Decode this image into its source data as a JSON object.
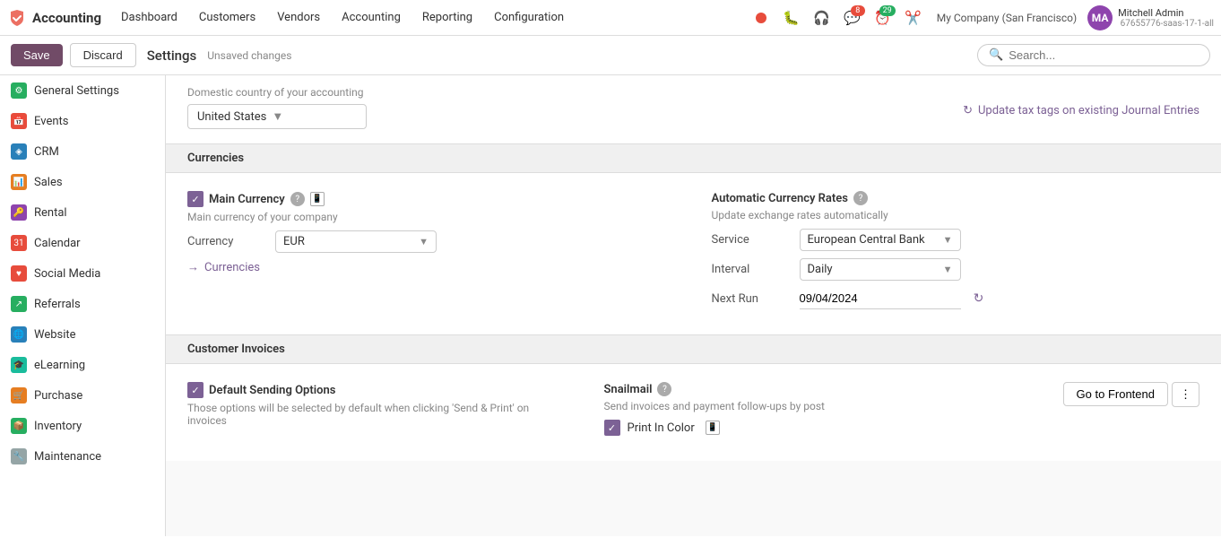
{
  "brand": {
    "name": "Accounting",
    "icon_color": "#e74c3c"
  },
  "nav": {
    "items": [
      {
        "label": "Dashboard",
        "key": "dashboard"
      },
      {
        "label": "Customers",
        "key": "customers"
      },
      {
        "label": "Vendors",
        "key": "vendors"
      },
      {
        "label": "Accounting",
        "key": "accounting"
      },
      {
        "label": "Reporting",
        "key": "reporting"
      },
      {
        "label": "Configuration",
        "key": "configuration"
      }
    ],
    "company": "My Company (San Francisco)",
    "user_name": "Mitchell Admin",
    "user_sub": "‎ 67655776-saas-17-1-all",
    "badge_msg": "8",
    "badge_activity": "29"
  },
  "toolbar": {
    "save_label": "Save",
    "discard_label": "Discard",
    "title": "Settings",
    "unsaved": "Unsaved changes",
    "search_placeholder": "Search..."
  },
  "sidebar": {
    "items": [
      {
        "label": "General Settings",
        "color": "#27ae60"
      },
      {
        "label": "Events",
        "color": "#e74c3c"
      },
      {
        "label": "CRM",
        "color": "#2980b9"
      },
      {
        "label": "Sales",
        "color": "#e67e22"
      },
      {
        "label": "Rental",
        "color": "#8e44ad"
      },
      {
        "label": "Calendar",
        "color": "#e74c3c"
      },
      {
        "label": "Social Media",
        "color": "#e74c3c"
      },
      {
        "label": "Referrals",
        "color": "#27ae60"
      },
      {
        "label": "Website",
        "color": "#2980b9"
      },
      {
        "label": "eLearning",
        "color": "#1abc9c"
      },
      {
        "label": "Purchase",
        "color": "#e67e22"
      },
      {
        "label": "Inventory",
        "color": "#27ae60"
      },
      {
        "label": "Maintenance",
        "color": "#95a5a6"
      }
    ]
  },
  "country_area": {
    "label": "Domestic country of your accounting",
    "value": "United States",
    "update_link": "Update tax tags on existing Journal Entries"
  },
  "currencies": {
    "section_title": "Currencies",
    "main_currency": {
      "title": "Main Currency",
      "desc": "Main currency of your company",
      "currency_label": "Currency",
      "currency_value": "EUR",
      "link_label": "Currencies",
      "checked": true
    },
    "auto_rates": {
      "title": "Automatic Currency Rates",
      "desc": "Update exchange rates automatically",
      "service_label": "Service",
      "service_value": "European Central Bank",
      "interval_label": "Interval",
      "interval_value": "Daily",
      "next_run_label": "Next Run",
      "next_run_value": "09/04/2024"
    }
  },
  "customer_invoices": {
    "section_title": "Customer Invoices",
    "default_sending": {
      "title": "Default Sending Options",
      "desc": "Those options will be selected by default when clicking 'Send & Print' on invoices",
      "checked": true
    },
    "snailmail": {
      "title": "Snailmail",
      "desc": "Send invoices and payment follow-ups by post",
      "print_in_color_label": "Print In Color",
      "print_in_color_checked": true
    }
  },
  "bottom_bar": {
    "go_frontend": "Go to Frontend",
    "more": "⋮"
  }
}
